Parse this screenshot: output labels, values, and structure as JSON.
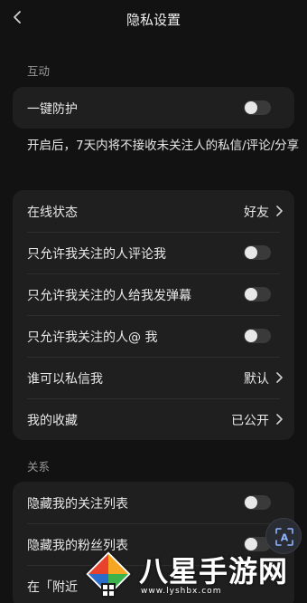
{
  "header": {
    "title": "隐私设置",
    "back_icon": "chevron-left-icon"
  },
  "sections": {
    "interaction": {
      "label": "互动",
      "one_click_protection": {
        "label": "一键防护",
        "enabled": false
      },
      "hint": "开启后，7天内将不接收未关注人的私信/评论/分享"
    },
    "settings": {
      "online_status": {
        "label": "在线状态",
        "value": "好友"
      },
      "comment_only_followed": {
        "label": "只允许我关注的人评论我",
        "enabled": false
      },
      "danmaku_only_followed": {
        "label": "只允许我关注的人给我发弹幕",
        "enabled": false
      },
      "mention_only_followed": {
        "label": "只允许我关注的人@ 我",
        "enabled": false
      },
      "who_can_message": {
        "label": "谁可以私信我",
        "value": "默认"
      },
      "my_favorites": {
        "label": "我的收藏",
        "value": "已公开"
      }
    },
    "relations": {
      "label": "关系",
      "hide_following": {
        "label": "隐藏我的关注列表",
        "enabled": false
      },
      "hide_fans": {
        "label": "隐藏我的粉丝列表",
        "enabled": false
      },
      "nearby": {
        "label": "在「附近"
      }
    }
  },
  "fab": {
    "icon": "scan-text-icon",
    "label": "A"
  },
  "watermark": {
    "text": "八星手游网",
    "url": "www.lyshbx.com"
  },
  "colors": {
    "background": "#121212",
    "card": "#1f1f1f",
    "toggle_off": "#3a3a3a",
    "text": "#e8e8e8",
    "muted": "#9a9a9a"
  }
}
